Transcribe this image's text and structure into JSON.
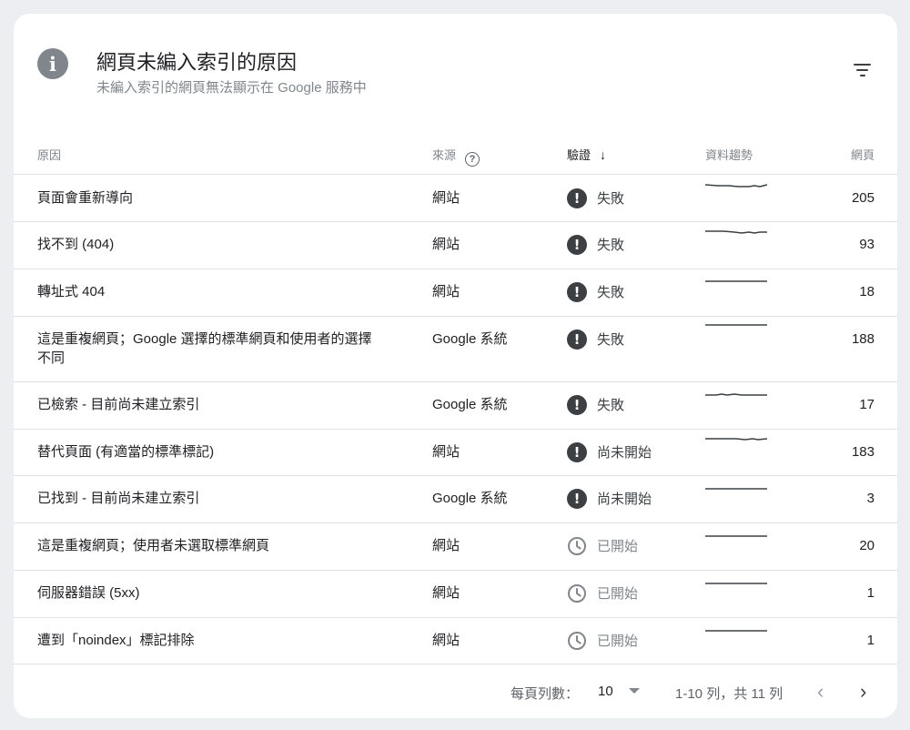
{
  "header": {
    "title": "網頁未編入索引的原因",
    "subtitle": "未編入索引的網頁無法顯示在 Google 服務中",
    "info_icon": "i",
    "filter_icon": "filter-icon"
  },
  "columns": {
    "reason": "原因",
    "source": "來源",
    "validation": "驗證",
    "trend": "資料趨勢",
    "pages": "網頁",
    "help_icon": "?",
    "sort_arrow": "↓"
  },
  "rows": [
    {
      "reason": "頁面會重新導向",
      "source": "網站",
      "status": "失敗",
      "status_type": "fail",
      "pages": "205"
    },
    {
      "reason": "找不到 (404)",
      "source": "網站",
      "status": "失敗",
      "status_type": "fail",
      "pages": "93"
    },
    {
      "reason": "轉址式 404",
      "source": "網站",
      "status": "失敗",
      "status_type": "fail",
      "pages": "18"
    },
    {
      "reason": "這是重複網頁；Google 選擇的標準網頁和使用者的選擇不同",
      "source": "Google 系統",
      "status": "失敗",
      "status_type": "fail",
      "pages": "188"
    },
    {
      "reason": "已檢索 - 目前尚未建立索引",
      "source": "Google 系統",
      "status": "失敗",
      "status_type": "fail",
      "pages": "17"
    },
    {
      "reason": "替代頁面 (有適當的標準標記)",
      "source": "網站",
      "status": "尚未開始",
      "status_type": "fail",
      "pages": "183"
    },
    {
      "reason": "已找到 - 目前尚未建立索引",
      "source": "Google 系統",
      "status": "尚未開始",
      "status_type": "fail",
      "pages": "3"
    },
    {
      "reason": "這是重複網頁；使用者未選取標準網頁",
      "source": "網站",
      "status": "已開始",
      "status_type": "started",
      "pages": "20"
    },
    {
      "reason": "伺服器錯誤 (5xx)",
      "source": "網站",
      "status": "已開始",
      "status_type": "started",
      "pages": "1"
    },
    {
      "reason": "遭到「noindex」標記排除",
      "source": "網站",
      "status": "已開始",
      "status_type": "started",
      "pages": "1"
    }
  ],
  "footer": {
    "rows_per_page_label": "每頁列數：",
    "rows_per_page_value": "10",
    "range_text": "1-10 列，共 11 列",
    "prev_icon": "‹",
    "next_icon": "›"
  },
  "colors": {
    "fail_icon": "#3c4043",
    "started_icon": "#80868b",
    "trend_line": "#3c4043",
    "background": "#eceef1"
  }
}
